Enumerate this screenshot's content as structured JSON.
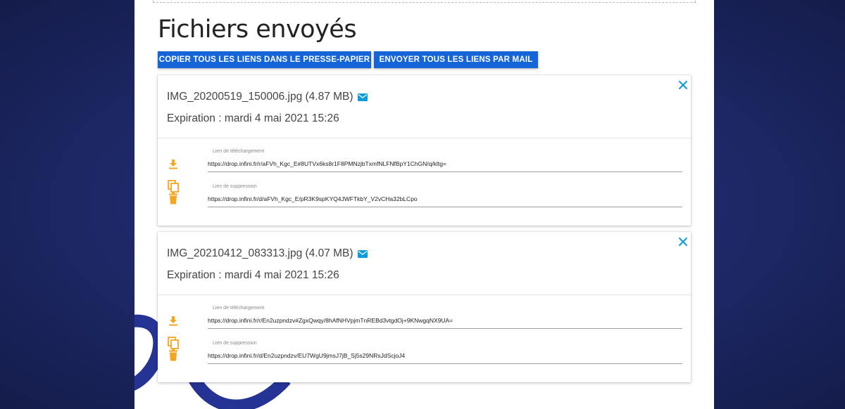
{
  "page": {
    "title": "Fichiers envoyés"
  },
  "actions": {
    "copy_all": "COPIER TOUS LES LIENS DANS LE PRESSE-PAPIER",
    "mail_all": "ENVOYER TOUS LES LIENS PAR MAIL"
  },
  "files": [
    {
      "name": "IMG_20200519_150006.jpg (4.87 MB)",
      "expiration": "Expiration : mardi 4 mai 2021 15:26",
      "download_label": "Lien de téléchargement",
      "download_url": "https://drop.infini.fr/r/aFVh_Kgc_E#8UTVx6ks8r1F8PMNzjbTxmfNLFNfBpY1ChGN/q/kltg=",
      "delete_label": "Lien de suppression",
      "delete_url": "https://drop.infini.fr/d/aFVh_Kgc_E/pR3K9spKYQ4JWFTkbY_V2vCHa32bLCpo"
    },
    {
      "name": "IMG_20210412_083313.jpg (4.07 MB)",
      "expiration": "Expiration : mardi 4 mai 2021 15:26",
      "download_label": "Lien de téléchargement",
      "download_url": "https://drop.infini.fr/r/En2uzpndzv#ZgxQwqy/8hAfNHVpjmTnREBd3vtgdOj+9KNwgqNX9UA=",
      "delete_label": "Lien de suppression",
      "delete_url": "https://drop.infini.fr/d/En2uzpndzv/EU7WgU9jmsJ7jB_Sj5s29NRsJdScjoJ4"
    }
  ],
  "icons": {
    "close": "close-icon",
    "mail": "mail-icon",
    "download": "download-icon",
    "copy": "copy-icon",
    "delete": "trash-icon"
  },
  "colors": {
    "primary_button": "#1565d8",
    "accent": "#0d9bd9",
    "icon_orange": "#f5a623",
    "background": "#1f2a6b"
  }
}
